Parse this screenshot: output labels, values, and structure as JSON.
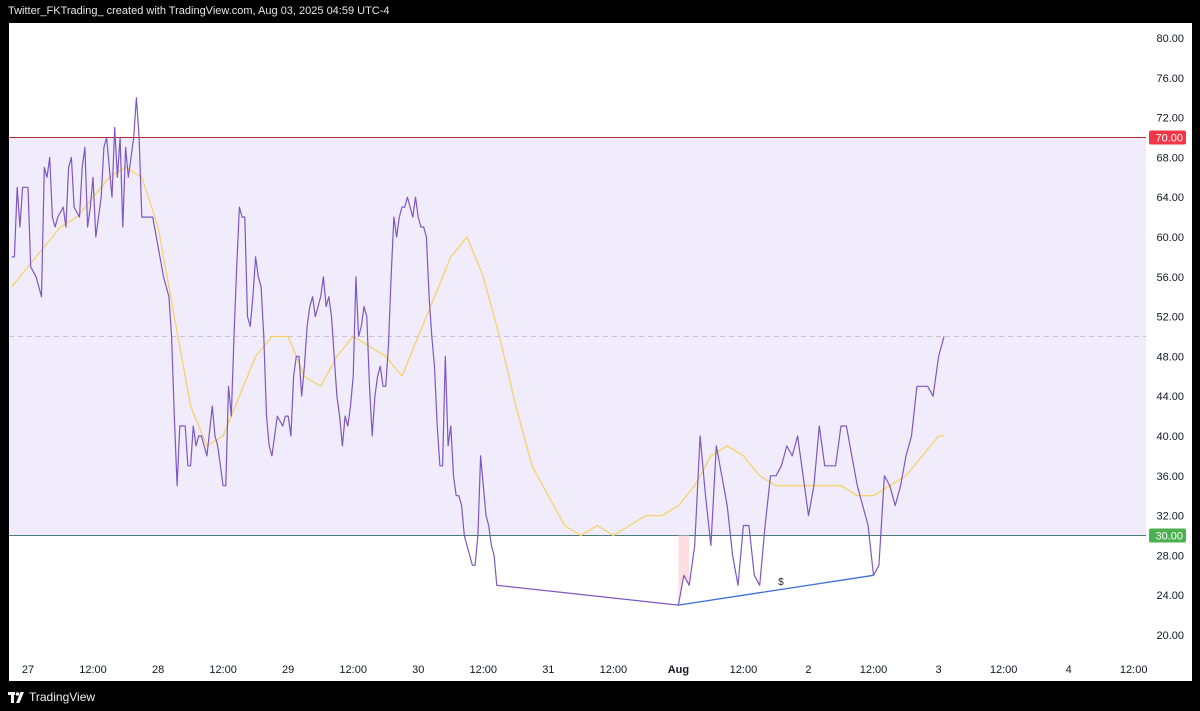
{
  "header": {
    "title": "Twitter_FKTrading_ created with TradingView.com, Aug 03, 2025 04:59 UTC-4"
  },
  "footer": {
    "brand": "TradingView",
    "logo_icon": "tradingview-logo-icon"
  },
  "colors": {
    "rsi_line": "#7e57c2",
    "ma_line": "#f5d26b",
    "band_fill": "#f1ecfb",
    "upper_line": "#b22833",
    "lower_line": "#4b7a7a",
    "upper_badge": "#f23645",
    "lower_badge": "#4caf50",
    "divergence_line": "#3d6fd6",
    "divergence_fill": "#ffd6dc"
  },
  "chart_data": {
    "type": "line",
    "title": "",
    "xlabel": "",
    "ylabel": "",
    "ylim": [
      17,
      83
    ],
    "y_ticks": [
      "80.00",
      "76.00",
      "72.00",
      "68.00",
      "64.00",
      "60.00",
      "56.00",
      "52.00",
      "48.00",
      "44.00",
      "40.00",
      "36.00",
      "32.00",
      "28.00",
      "24.00",
      "20.00"
    ],
    "x_ticks": [
      {
        "label": "27",
        "t": 0
      },
      {
        "label": "12:00",
        "t": 12
      },
      {
        "label": "28",
        "t": 24
      },
      {
        "label": "12:00",
        "t": 36
      },
      {
        "label": "29",
        "t": 48
      },
      {
        "label": "12:00",
        "t": 60
      },
      {
        "label": "30",
        "t": 72
      },
      {
        "label": "12:00",
        "t": 84
      },
      {
        "label": "31",
        "t": 96
      },
      {
        "label": "12:00",
        "t": 108
      },
      {
        "label": "Aug",
        "t": 120
      },
      {
        "label": "12:00",
        "t": 132
      },
      {
        "label": "2",
        "t": 144
      },
      {
        "label": "12:00",
        "t": 156
      },
      {
        "label": "3",
        "t": 168
      },
      {
        "label": "12:00",
        "t": 180
      },
      {
        "label": "4",
        "t": 192
      },
      {
        "label": "12:00",
        "t": 204
      }
    ],
    "hlines": [
      {
        "value": 70,
        "label": "70.00",
        "kind": "overbought"
      },
      {
        "value": 30,
        "label": "30.00",
        "kind": "oversold"
      },
      {
        "value": 50,
        "label": "",
        "kind": "midline"
      }
    ],
    "series": [
      {
        "values": [
          [
            -3,
            58
          ],
          [
            -2.5,
            58
          ],
          [
            -2,
            65
          ],
          [
            -1.5,
            61
          ],
          [
            -1,
            65
          ],
          [
            0,
            65
          ],
          [
            0.5,
            57
          ],
          [
            1.5,
            56
          ],
          [
            2.5,
            54
          ],
          [
            3,
            67
          ],
          [
            3.5,
            66
          ],
          [
            4,
            68
          ],
          [
            4.5,
            62
          ],
          [
            5,
            61
          ],
          [
            5.5,
            62
          ],
          [
            6.5,
            63
          ],
          [
            7,
            61
          ],
          [
            7.5,
            67
          ],
          [
            8,
            68
          ],
          [
            8.5,
            63
          ],
          [
            9.5,
            62
          ],
          [
            10,
            67
          ],
          [
            10.5,
            69
          ],
          [
            11,
            61
          ],
          [
            11.5,
            63
          ],
          [
            12,
            66
          ],
          [
            12.5,
            60
          ],
          [
            13.5,
            64
          ],
          [
            14,
            69
          ],
          [
            14.5,
            70
          ],
          [
            15,
            67
          ],
          [
            15.5,
            64
          ],
          [
            16,
            71
          ],
          [
            16.5,
            66
          ],
          [
            17,
            70
          ],
          [
            17.5,
            61
          ],
          [
            18,
            69
          ],
          [
            18.5,
            66
          ],
          [
            19,
            68
          ],
          [
            19.5,
            70
          ],
          [
            20,
            74
          ],
          [
            20.5,
            70
          ],
          [
            21,
            62
          ],
          [
            21.5,
            62
          ],
          [
            22,
            62
          ],
          [
            22.5,
            62
          ],
          [
            23,
            62
          ],
          [
            24,
            59
          ],
          [
            25,
            56
          ],
          [
            26,
            54
          ],
          [
            26.5,
            50
          ],
          [
            27,
            42
          ],
          [
            27.5,
            35
          ],
          [
            28,
            41
          ],
          [
            28.5,
            41
          ],
          [
            29,
            41
          ],
          [
            29.5,
            37
          ],
          [
            30,
            37
          ],
          [
            30.5,
            41
          ],
          [
            31,
            39
          ],
          [
            31.5,
            40
          ],
          [
            32,
            40
          ],
          [
            33,
            38
          ],
          [
            34,
            43
          ],
          [
            34.5,
            40
          ],
          [
            35,
            39
          ],
          [
            35.5,
            37
          ],
          [
            36,
            35
          ],
          [
            36.5,
            35
          ],
          [
            37,
            45
          ],
          [
            37.5,
            42
          ],
          [
            38,
            50
          ],
          [
            38.5,
            57
          ],
          [
            39,
            63
          ],
          [
            39.5,
            62
          ],
          [
            40,
            62
          ],
          [
            40.5,
            52
          ],
          [
            41,
            51
          ],
          [
            41.5,
            54
          ],
          [
            42,
            58
          ],
          [
            42.5,
            56
          ],
          [
            43,
            55
          ],
          [
            43.5,
            50
          ],
          [
            44,
            42
          ],
          [
            44.5,
            39
          ],
          [
            45,
            38
          ],
          [
            45.5,
            40
          ],
          [
            46,
            42
          ],
          [
            47,
            41
          ],
          [
            47.5,
            42
          ],
          [
            48,
            42
          ],
          [
            48.5,
            40
          ],
          [
            49,
            46
          ],
          [
            49.5,
            48
          ],
          [
            50,
            48
          ],
          [
            50.5,
            44
          ],
          [
            51,
            47
          ],
          [
            51.5,
            51
          ],
          [
            52,
            53
          ],
          [
            52.5,
            54
          ],
          [
            53,
            52
          ],
          [
            54,
            54
          ],
          [
            54.5,
            56
          ],
          [
            55,
            53
          ],
          [
            55.5,
            54
          ],
          [
            56,
            52
          ],
          [
            56.5,
            48
          ],
          [
            57,
            44
          ],
          [
            57.5,
            42
          ],
          [
            58,
            39
          ],
          [
            58.5,
            42
          ],
          [
            59,
            41
          ],
          [
            59.5,
            43
          ],
          [
            60,
            46
          ],
          [
            60.5,
            56
          ],
          [
            61,
            50
          ],
          [
            61.5,
            51
          ],
          [
            62,
            53
          ],
          [
            62.5,
            52
          ],
          [
            63,
            45
          ],
          [
            63.5,
            40
          ],
          [
            64,
            44
          ],
          [
            64.5,
            46
          ],
          [
            65,
            47
          ],
          [
            65.5,
            45
          ],
          [
            66,
            45
          ],
          [
            66.5,
            49
          ],
          [
            67,
            56
          ],
          [
            67.5,
            62
          ],
          [
            68,
            60
          ],
          [
            68.5,
            62
          ],
          [
            69,
            63
          ],
          [
            69.5,
            63
          ],
          [
            70,
            64
          ],
          [
            70.5,
            63
          ],
          [
            71,
            62
          ],
          [
            71.5,
            64
          ],
          [
            72,
            62
          ],
          [
            72.5,
            61
          ],
          [
            73,
            61
          ],
          [
            73.5,
            60
          ],
          [
            74,
            54
          ],
          [
            74.5,
            50
          ],
          [
            75,
            47
          ],
          [
            75.5,
            41
          ],
          [
            76,
            37
          ],
          [
            76.5,
            37
          ],
          [
            77,
            48
          ],
          [
            77.5,
            39
          ],
          [
            78,
            41
          ],
          [
            78.5,
            36
          ],
          [
            79,
            34
          ],
          [
            79.5,
            34
          ],
          [
            80,
            33
          ],
          [
            80.5,
            30
          ],
          [
            81,
            29
          ],
          [
            81.5,
            28
          ],
          [
            82,
            27
          ],
          [
            82.5,
            27
          ],
          [
            83,
            30
          ],
          [
            83.5,
            38
          ],
          [
            84,
            35
          ],
          [
            84.5,
            32
          ],
          [
            85,
            31
          ],
          [
            85.5,
            29
          ],
          [
            86,
            28
          ],
          [
            86.5,
            25
          ],
          [
            120,
            23
          ],
          [
            121,
            26
          ],
          [
            122,
            25
          ],
          [
            123,
            29
          ],
          [
            124,
            40
          ],
          [
            125,
            34
          ],
          [
            126,
            29
          ],
          [
            127,
            39
          ],
          [
            128,
            36
          ],
          [
            129,
            33
          ],
          [
            130,
            28
          ],
          [
            131,
            25
          ],
          [
            132,
            31
          ],
          [
            133,
            31
          ],
          [
            134,
            26
          ],
          [
            135,
            25
          ],
          [
            136,
            31
          ],
          [
            137,
            36
          ],
          [
            138,
            36
          ],
          [
            139,
            37
          ],
          [
            140,
            39
          ],
          [
            141,
            38
          ],
          [
            142,
            40
          ],
          [
            143,
            36
          ],
          [
            144,
            32
          ],
          [
            145,
            35
          ],
          [
            146,
            41
          ],
          [
            147,
            37
          ],
          [
            148,
            37
          ],
          [
            149,
            37
          ],
          [
            150,
            41
          ],
          [
            151,
            41
          ],
          [
            152,
            38
          ],
          [
            153,
            35
          ],
          [
            154,
            33
          ],
          [
            155,
            31
          ],
          [
            156,
            26
          ],
          [
            157,
            27
          ],
          [
            158,
            36
          ],
          [
            159,
            35
          ],
          [
            160,
            33
          ],
          [
            161,
            35
          ],
          [
            162,
            38
          ],
          [
            163,
            40
          ],
          [
            164,
            45
          ],
          [
            165,
            45
          ],
          [
            166,
            45
          ],
          [
            167,
            44
          ],
          [
            168,
            48
          ],
          [
            169,
            50
          ]
        ]
      },
      {
        "values": [
          [
            -3,
            55
          ],
          [
            0,
            57
          ],
          [
            3,
            59
          ],
          [
            6,
            61
          ],
          [
            9,
            62
          ],
          [
            12,
            64
          ],
          [
            15,
            66
          ],
          [
            18,
            67
          ],
          [
            21,
            66
          ],
          [
            24,
            61
          ],
          [
            27,
            52
          ],
          [
            30,
            43
          ],
          [
            33,
            39
          ],
          [
            36,
            40
          ],
          [
            39,
            44
          ],
          [
            42,
            48
          ],
          [
            45,
            50
          ],
          [
            48,
            50
          ],
          [
            51,
            46
          ],
          [
            54,
            45
          ],
          [
            57,
            48
          ],
          [
            60,
            50
          ],
          [
            63,
            49
          ],
          [
            66,
            48
          ],
          [
            69,
            46
          ],
          [
            72,
            50
          ],
          [
            75,
            54
          ],
          [
            78,
            58
          ],
          [
            81,
            60
          ],
          [
            84,
            56
          ],
          [
            87,
            50
          ],
          [
            90,
            43
          ],
          [
            93,
            37
          ],
          [
            96,
            34
          ],
          [
            99,
            31
          ],
          [
            102,
            30
          ],
          [
            105,
            31
          ],
          [
            108,
            30
          ],
          [
            111,
            31
          ],
          [
            114,
            32
          ],
          [
            117,
            32
          ],
          [
            120,
            33
          ],
          [
            123,
            35
          ],
          [
            126,
            38
          ],
          [
            129,
            39
          ],
          [
            132,
            38
          ],
          [
            135,
            36
          ],
          [
            138,
            35
          ],
          [
            141,
            35
          ],
          [
            144,
            35
          ],
          [
            147,
            35
          ],
          [
            150,
            35
          ],
          [
            153,
            34
          ],
          [
            156,
            34
          ],
          [
            159,
            35
          ],
          [
            162,
            36
          ],
          [
            165,
            38
          ],
          [
            168,
            40
          ],
          [
            169,
            40
          ]
        ]
      }
    ],
    "divergence": {
      "points": [
        [
          120,
          23
        ],
        [
          156,
          26
        ]
      ],
      "label": "$"
    }
  }
}
